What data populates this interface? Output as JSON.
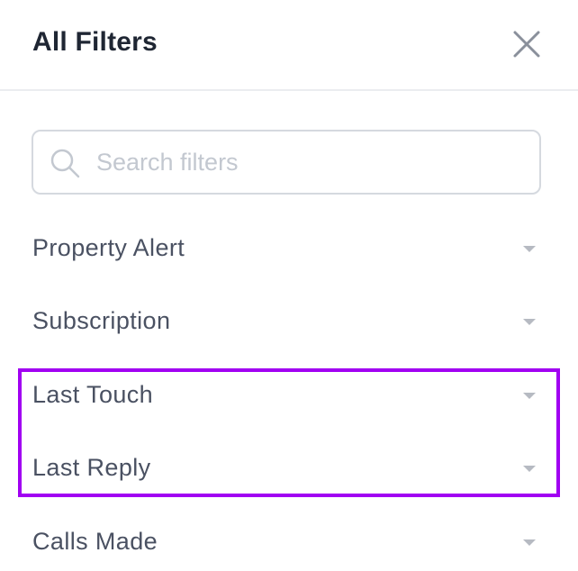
{
  "header": {
    "title": "All Filters",
    "close_icon": "close-icon"
  },
  "search": {
    "placeholder": "Search filters",
    "value": "",
    "icon": "search-icon"
  },
  "filters": [
    {
      "label": "Property Alert",
      "icon": "chevron-down-icon"
    },
    {
      "label": "Subscription",
      "icon": "chevron-down-icon"
    },
    {
      "label": "Last Touch",
      "icon": "chevron-down-icon"
    },
    {
      "label": "Last Reply",
      "icon": "chevron-down-icon"
    },
    {
      "label": "Calls Made",
      "icon": "chevron-down-icon"
    }
  ],
  "colors": {
    "title": "#1f2633",
    "label": "#4a5162",
    "placeholder": "#c3c8d0",
    "border": "#d5d9df",
    "caret": "#b6bac2",
    "highlight": "#a100f2"
  }
}
